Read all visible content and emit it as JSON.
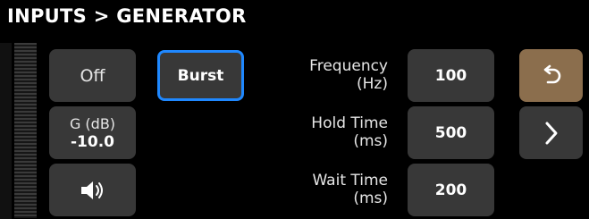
{
  "header": {
    "title": "INPUTS > GENERATOR"
  },
  "buttons": {
    "off_label": "Off",
    "gain_label": "G (dB)",
    "gain_value": "-10.0",
    "mode_label": "Burst"
  },
  "params": {
    "frequency": {
      "label_line1": "Frequency",
      "label_line2": "(Hz)",
      "value": "100"
    },
    "hold_time": {
      "label_line1": "Hold Time",
      "label_line2": "(ms)",
      "value": "500"
    },
    "wait_time": {
      "label_line1": "Wait Time",
      "label_line2": "(ms)",
      "value": "200"
    }
  },
  "icons": {
    "speaker": "speaker-icon",
    "undo": "undo-icon",
    "next": "chevron-right-icon"
  },
  "colors": {
    "background": "#000000",
    "button": "#383838",
    "selected_border": "#1f88ff",
    "undo_button": "#8b6e4d"
  }
}
